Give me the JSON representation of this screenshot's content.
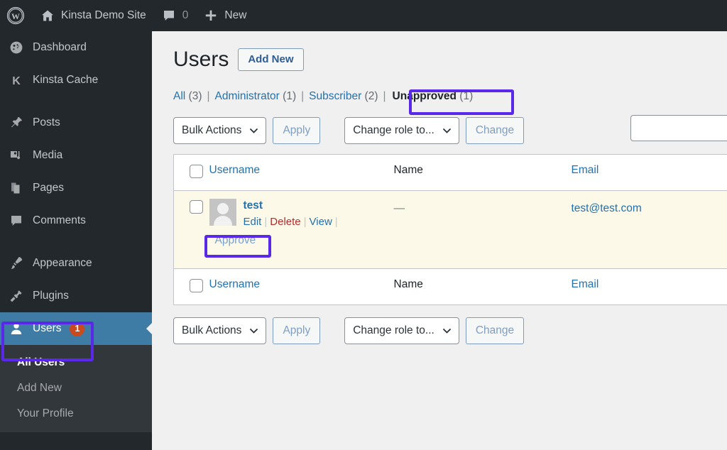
{
  "adminbar": {
    "logo_icon": "wordpress-logo-icon",
    "home_icon": "home-icon",
    "site_name": "Kinsta Demo Site",
    "comments_icon": "comment-bubble-icon",
    "comments_count": "0",
    "new_icon": "plus-icon",
    "new_label": "New"
  },
  "sidebar": {
    "items": [
      {
        "label": "Dashboard",
        "icon": "dashboard-gauge-icon"
      },
      {
        "label": "Kinsta Cache",
        "icon": "kinsta-k-icon"
      },
      {
        "label": "Posts",
        "icon": "pin-icon"
      },
      {
        "label": "Media",
        "icon": "media-icon"
      },
      {
        "label": "Pages",
        "icon": "pages-icon"
      },
      {
        "label": "Comments",
        "icon": "comment-bubble-icon"
      },
      {
        "label": "Appearance",
        "icon": "paintbrush-icon"
      },
      {
        "label": "Plugins",
        "icon": "plug-icon"
      },
      {
        "label": "Users",
        "icon": "user-icon",
        "badge": "1",
        "current": true
      }
    ],
    "submenu": [
      {
        "label": "All Users",
        "current": true
      },
      {
        "label": "Add New",
        "current": false
      },
      {
        "label": "Your Profile",
        "current": false
      }
    ]
  },
  "main": {
    "title": "Users",
    "add_new_label": "Add New",
    "filters": [
      {
        "label": "All",
        "count": "(3)",
        "current": false
      },
      {
        "label": "Administrator",
        "count": "(1)",
        "current": false
      },
      {
        "label": "Subscriber",
        "count": "(2)",
        "current": false
      },
      {
        "label": "Unapproved",
        "count": "(1)",
        "current": true
      }
    ],
    "search": {
      "value": "",
      "placeholder": ""
    },
    "tablenav": {
      "bulk_actions_label": "Bulk Actions",
      "apply_label": "Apply",
      "change_role_label": "Change role to...",
      "change_label": "Change"
    },
    "table": {
      "columns": [
        {
          "label": "Username",
          "sortable": true
        },
        {
          "label": "Name",
          "sortable": false
        },
        {
          "label": "Email",
          "sortable": true
        }
      ],
      "rows": [
        {
          "username": "test",
          "name": "—",
          "email": "test@test.com",
          "avatar_icon": "user-avatar-placeholder-icon",
          "actions": [
            {
              "label": "Edit",
              "kind": "edit"
            },
            {
              "label": "Delete",
              "kind": "delete"
            },
            {
              "label": "View",
              "kind": "view"
            }
          ],
          "approve_label": "Approve"
        }
      ]
    }
  },
  "annotations": {
    "color": "#5a28e8",
    "targets": [
      "sidebar-item-users",
      "filter-unapproved",
      "approve-link"
    ]
  },
  "colors": {
    "admin_bar": "#23282d",
    "sidebar": "#23282d",
    "submenu": "#32373c",
    "current_item": "#3e7ca6",
    "badge": "#ca4a1f",
    "link": "#2271b1",
    "delete_link": "#b32d2e",
    "row_highlight": "#fcf9e8",
    "content_bg": "#f0f0f1"
  }
}
